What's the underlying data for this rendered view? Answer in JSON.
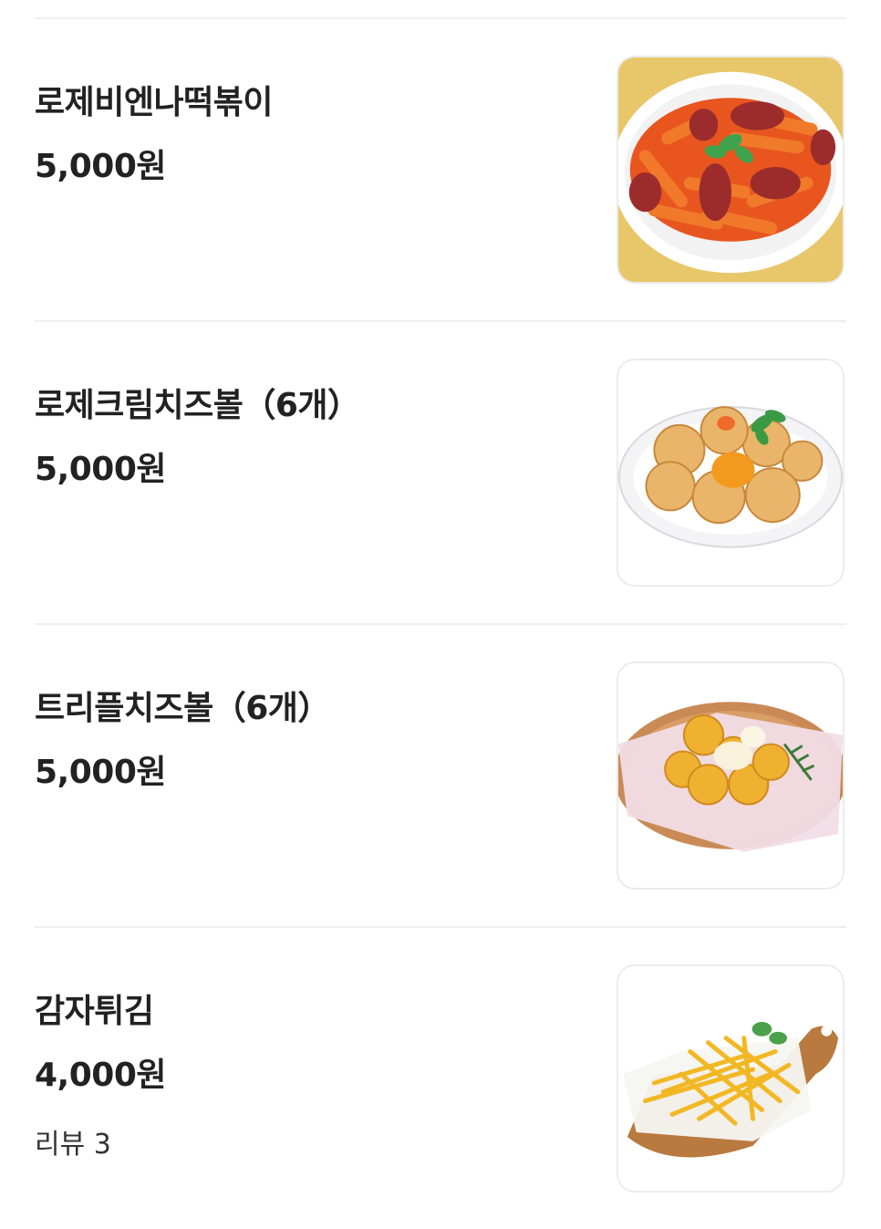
{
  "menu": {
    "items": [
      {
        "name": "로제비엔나떡볶이",
        "price": "5,000원",
        "image": "rose-vienna-tteokbokki-photo"
      },
      {
        "name": "로제크림치즈볼（6개）",
        "price": "5,000원",
        "image": "rose-cream-cheese-ball-photo"
      },
      {
        "name": "트리플치즈볼（6개）",
        "price": "5,000원",
        "image": "triple-cheese-ball-photo"
      },
      {
        "name": "감자튀김",
        "price": "4,000원",
        "review": "리뷰 3",
        "image": "french-fries-photo"
      }
    ]
  }
}
